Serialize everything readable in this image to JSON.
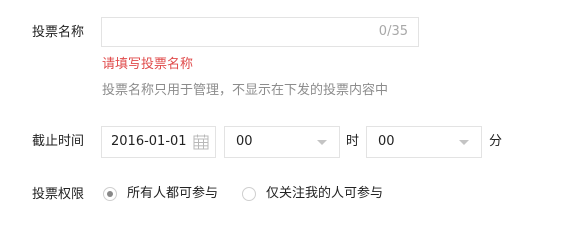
{
  "vote_name": {
    "label": "投票名称",
    "value": "",
    "placeholder": "",
    "counter": "0/35",
    "error": "请填写投票名称",
    "hint": "投票名称只用于管理，不显示在下发的投票内容中"
  },
  "deadline": {
    "label": "截止时间",
    "date": "2016-01-01",
    "hour": "00",
    "hour_unit": "时",
    "minute": "00",
    "minute_unit": "分"
  },
  "permission": {
    "label": "投票权限",
    "options": [
      {
        "label": "所有人都可参与",
        "selected": true
      },
      {
        "label": "仅关注我的人可参与",
        "selected": false
      }
    ]
  },
  "colors": {
    "error": "#e04b4b",
    "hint": "#8c8c8c",
    "border": "#e3e3e3"
  }
}
